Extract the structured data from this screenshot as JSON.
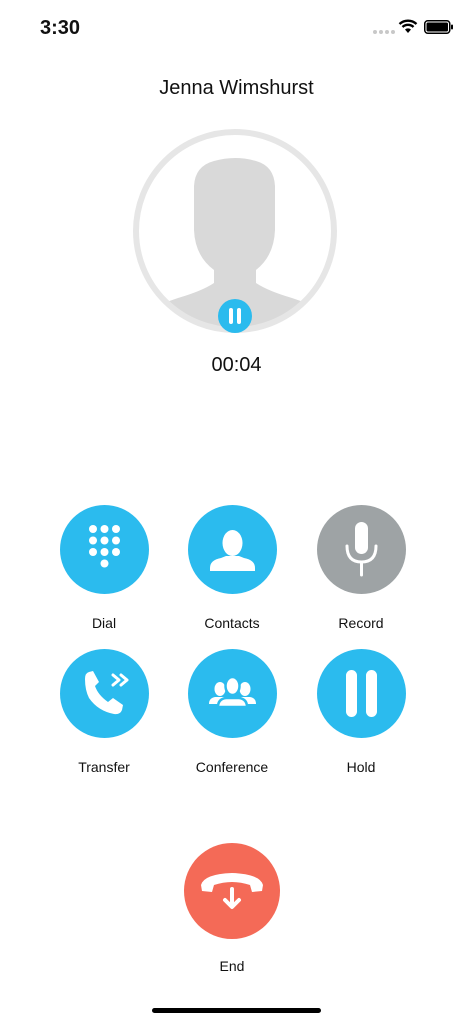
{
  "status_bar": {
    "time": "3:30"
  },
  "call": {
    "caller_name": "Jenna Wimshurst",
    "duration": "00:04",
    "on_hold_badge": true
  },
  "actions": {
    "dial": {
      "label": "Dial",
      "icon": "keypad-icon"
    },
    "contacts": {
      "label": "Contacts",
      "icon": "person-icon"
    },
    "record": {
      "label": "Record",
      "icon": "microphone-icon"
    },
    "transfer": {
      "label": "Transfer",
      "icon": "phone-forward-icon"
    },
    "conference": {
      "label": "Conference",
      "icon": "group-icon"
    },
    "hold": {
      "label": "Hold",
      "icon": "pause-icon"
    }
  },
  "end_call": {
    "label": "End",
    "icon": "hang-up-icon"
  },
  "colors": {
    "accent": "#2bbbee",
    "disabled": "#9ea3a5",
    "end": "#f46a57",
    "avatar_ring": "#e6e6e6"
  }
}
